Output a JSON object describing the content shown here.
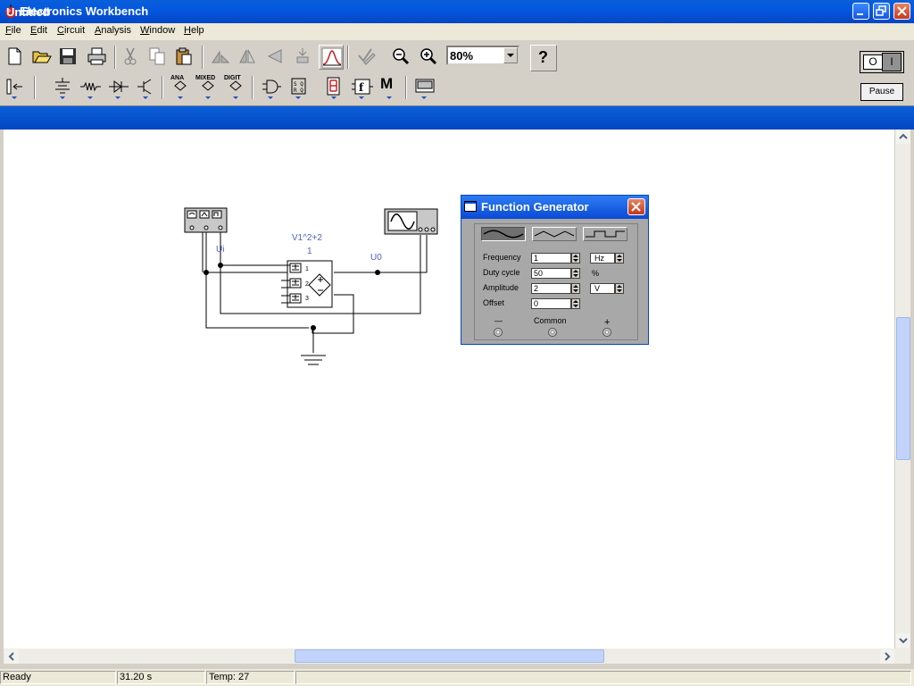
{
  "window": {
    "title": "Electronics Workbench"
  },
  "menu": [
    {
      "label": "File",
      "u": "F",
      "rest": "ile"
    },
    {
      "label": "Edit",
      "u": "E",
      "rest": "dit"
    },
    {
      "label": "Circuit",
      "u": "C",
      "rest": "ircuit"
    },
    {
      "label": "Analysis",
      "u": "A",
      "rest": "nalysis"
    },
    {
      "label": "Window",
      "u": "W",
      "rest": "indow"
    },
    {
      "label": "Help",
      "u": "H",
      "rest": "elp"
    }
  ],
  "toolbar": {
    "zoom_value": "80%",
    "help_label": "?",
    "pause_label": "Pause",
    "power_off": "O",
    "power_on": "I",
    "part_labels": {
      "analog": "ANA",
      "mixed": "MIXED",
      "digital": "DIGIT",
      "misc": "M"
    }
  },
  "document": {
    "title": "Untitled"
  },
  "circuit": {
    "block_label": "V1^2+2",
    "block_num": "1",
    "input_label": "Ui",
    "output_label": "U0",
    "pin_labels": [
      "1",
      "2",
      "3"
    ]
  },
  "function_generator": {
    "title": "Function Generator",
    "fields": [
      {
        "label": "Frequency",
        "value": "1",
        "unit": "Hz"
      },
      {
        "label": "Duty cycle",
        "value": "50",
        "unit": "%"
      },
      {
        "label": "Amplitude",
        "value": "2",
        "unit": "V"
      },
      {
        "label": "Offset",
        "value": "0",
        "unit": ""
      }
    ],
    "terminals": {
      "minus": "—",
      "common": "Common",
      "plus": "+"
    }
  },
  "status": {
    "state": "Ready",
    "time": "31.20 s",
    "temp": "Temp:  27"
  },
  "colors": {
    "titlebar": "#0458e0",
    "canvas": "#ffffff",
    "circuit_label": "#5060c8"
  }
}
